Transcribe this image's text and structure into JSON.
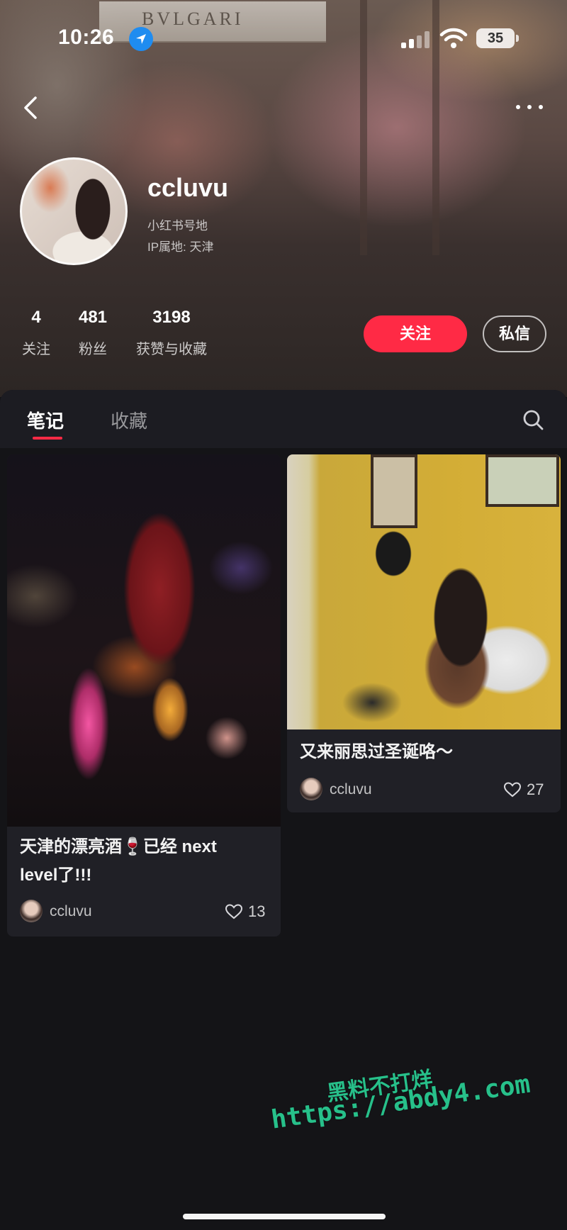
{
  "status_bar": {
    "time": "10:26",
    "battery": "35"
  },
  "header": {
    "sign_text": "BVLGARI"
  },
  "profile": {
    "username": "ccluvu",
    "xhs_id_line": "小红书号地",
    "ip_line": "IP属地: 天津"
  },
  "stats": [
    {
      "value": "4",
      "label": "关注"
    },
    {
      "value": "481",
      "label": "粉丝"
    },
    {
      "value": "3198",
      "label": "获赞与收藏"
    }
  ],
  "actions": {
    "follow": "关注",
    "message": "私信"
  },
  "tabs": [
    {
      "label": "笔记",
      "active": true
    },
    {
      "label": "收藏",
      "active": false
    }
  ],
  "notes": [
    {
      "title_line1": "天津的漂亮酒🍷已经 next",
      "title_line2": "level了!!!",
      "author": "ccluvu",
      "likes": "13"
    },
    {
      "title_line1": "又来丽思过圣诞咯～",
      "author": "ccluvu",
      "likes": "27"
    }
  ],
  "watermark": {
    "cn": "黑料不打烊",
    "url": "https://abdy4.com"
  },
  "colors": {
    "accent": "#ff2a45",
    "watermark": "#27c08a",
    "background": "#141417"
  }
}
